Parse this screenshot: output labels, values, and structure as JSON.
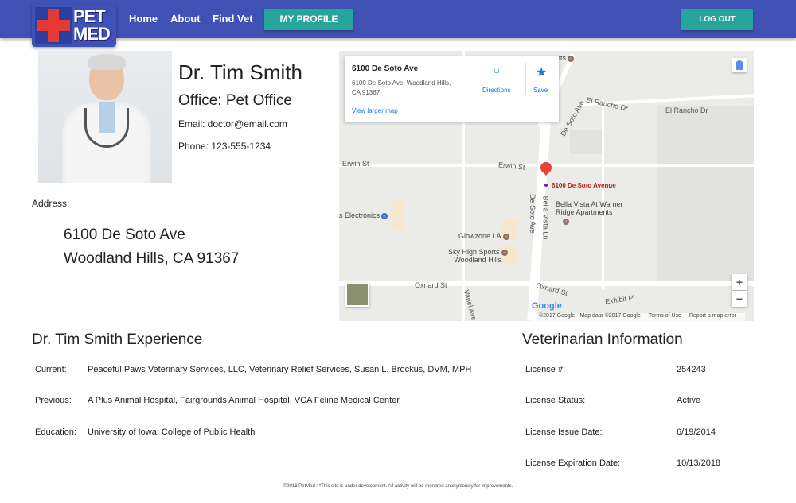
{
  "header": {
    "logo_line1": "PET",
    "logo_line2": "MED",
    "nav": [
      "Home",
      "About",
      "Find Vet"
    ],
    "profile_button": "MY PROFILE",
    "logout_button": "LOG OUT",
    "bar_color": "#3f51b5",
    "accent_color": "#26a69a"
  },
  "profile": {
    "name": "Dr. Tim Smith",
    "office": "Office: Pet Office",
    "email": "Email: doctor@email.com",
    "phone": "Phone: 123-555-1234",
    "address_label": "Address:",
    "address_line1": "6100 De Soto Ave",
    "address_line2": "Woodland Hills, CA 91367"
  },
  "map": {
    "info_title": "6100 De Soto Ave",
    "info_address1": "6100 De Soto Ave, Woodland Hills,",
    "info_address2": "CA 91367",
    "view_larger": "View larger map",
    "directions": "Directions",
    "save": "Save",
    "streets": [
      "El Rancho Dr",
      "El Rancho Dr",
      "Erwin St",
      "Erwin St",
      "De Soto Ave",
      "De Soto Ave",
      "Bella Vista Ln",
      "Oxnard St",
      "Oxnard St",
      "Exhibit Pl",
      "Variel Ave"
    ],
    "pois": [
      "s Electronics",
      "Glowzone LA",
      "Sky High Sports",
      "Woodland Hills",
      "Bella Vista At Warner",
      "Ridge Apartments",
      "ents"
    ],
    "pin_label": "6100 De Soto Avenue",
    "google": "Google",
    "footer": [
      "©2017 Google - Map data ©2017 Google",
      "Terms of Use",
      "Report a map error"
    ],
    "zoom_in": "+",
    "zoom_out": "−"
  },
  "experience": {
    "title": "Dr. Tim Smith Experience",
    "rows": [
      {
        "label": "Current:",
        "value": "Peaceful Paws Veterinary Services, LLC, Veterinary Relief Services, Susan L. Brockus, DVM, MPH"
      },
      {
        "label": "Previous:",
        "value": "A Plus Animal Hospital, Fairgrounds Animal Hospital, VCA Feline Medical Center"
      },
      {
        "label": "Education:",
        "value": "University of Iowa, College of Public Health"
      }
    ]
  },
  "vet_info": {
    "title": "Veterinarian Information",
    "rows": [
      {
        "label": "License #:",
        "value": "254243"
      },
      {
        "label": "License Status:",
        "value": "Active"
      },
      {
        "label": "License Issue Date:",
        "value": "6/19/2014"
      },
      {
        "label": "License Expiration Date:",
        "value": "10/13/2018"
      }
    ]
  },
  "footer": "©2016 PetMed : *This site is under development. All activity will be monitred anonymously for improvements."
}
